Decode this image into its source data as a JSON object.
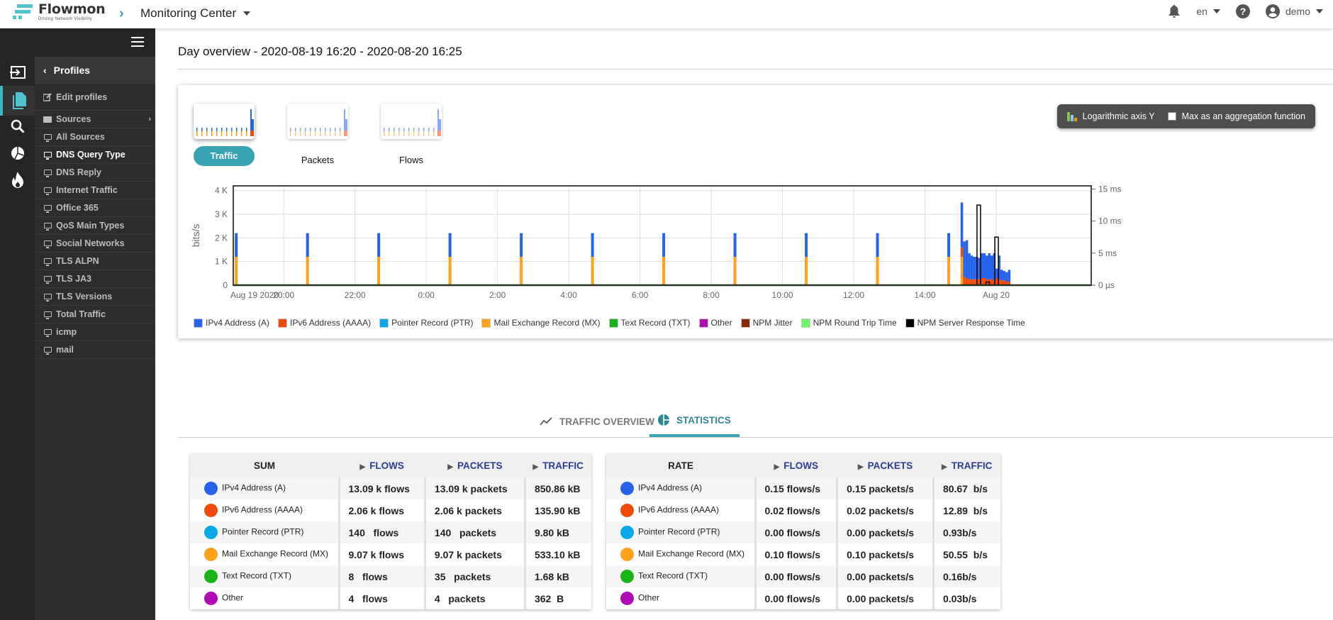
{
  "app": {
    "logo_name": "Flowmon",
    "logo_tagline": "Driving Network Visibility",
    "breadcrumb": "Monitoring Center",
    "language": "en",
    "user": "demo",
    "brand_color": "#37a3b3"
  },
  "sidebar": {
    "header": "Profiles",
    "edit": "Edit profiles",
    "sources": "Sources",
    "items": [
      {
        "label": "All Sources",
        "active": false
      },
      {
        "label": "DNS Query Type",
        "active": true
      },
      {
        "label": "DNS Reply",
        "active": false
      },
      {
        "label": "Internet Traffic",
        "active": false
      },
      {
        "label": "Office 365",
        "active": false
      },
      {
        "label": "QoS Main Types",
        "active": false
      },
      {
        "label": "Social Networks",
        "active": false
      },
      {
        "label": "TLS ALPN",
        "active": false
      },
      {
        "label": "TLS JA3",
        "active": false
      },
      {
        "label": "TLS Versions",
        "active": false
      },
      {
        "label": "Total Traffic",
        "active": false
      },
      {
        "label": "icmp",
        "active": false
      },
      {
        "label": "mail",
        "active": false
      }
    ],
    "rail_icons": [
      "sign-in-icon",
      "profiles-icon",
      "search-icon",
      "pie-chart-icon",
      "fire-icon"
    ]
  },
  "page": {
    "title": "Day overview - 2020-08-19 16:20 - 2020-08-20 16:25"
  },
  "thumbs": [
    {
      "label": "Traffic",
      "active": true
    },
    {
      "label": "Packets",
      "active": false
    },
    {
      "label": "Flows",
      "active": false
    }
  ],
  "options": {
    "log_axis": "Logarithmic axis Y",
    "max_agg": "Max as an aggregation function",
    "max_agg_checked": false
  },
  "chart_data": {
    "type": "bar",
    "stacked": true,
    "ylabel": "bits/s",
    "y_ticks": [
      "0",
      "1 K",
      "2 K",
      "3 K",
      "4 K"
    ],
    "ylim": [
      0,
      4200
    ],
    "y2_ticks": [
      "0 µs",
      "5 ms",
      "10 ms",
      "15 ms"
    ],
    "y2lim": [
      0,
      15.5
    ],
    "x_ticks": [
      "Aug 19 2020",
      "20:00",
      "22:00",
      "0:00",
      "2:00",
      "4:00",
      "6:00",
      "8:00",
      "10:00",
      "12:00",
      "14:00",
      "Aug 20"
    ],
    "grid": true,
    "periodic_spikes": {
      "times": [
        "18:40",
        "20:40",
        "22:40",
        "0:40",
        "2:40",
        "4:40",
        "6:40",
        "8:40",
        "10:40",
        "12:40",
        "14:40"
      ],
      "ipv4": 1000,
      "mx": 1200
    },
    "tail_series": {
      "start": "15:00",
      "ipv4": [
        1900,
        1500,
        1600,
        1100,
        1000,
        950,
        950,
        900,
        1050,
        1050,
        1000,
        1100,
        1000,
        1150,
        400,
        1000,
        450,
        400,
        400,
        500
      ],
      "ipv6": [
        400,
        350,
        300,
        250,
        250,
        250,
        250,
        250,
        300,
        300,
        250,
        250,
        250,
        200,
        300,
        250,
        200,
        200,
        150,
        150
      ],
      "mx": [
        1200,
        0,
        0,
        0,
        0,
        0,
        0,
        0,
        0,
        0,
        0,
        0,
        0,
        0,
        0,
        0,
        0,
        0,
        0,
        0
      ],
      "srt_ms": [
        {
          "time": "15:30",
          "value": 12.5
        },
        {
          "time": "16:00",
          "value": 7.5
        },
        {
          "time": "15:45",
          "value": 0.5
        }
      ]
    },
    "legend": [
      {
        "name": "IPv4 Address (A)",
        "color": "#2563eb"
      },
      {
        "name": "IPv6 Address (AAAA)",
        "color": "#f04a0a"
      },
      {
        "name": "Pointer Record (PTR)",
        "color": "#0aa8e8"
      },
      {
        "name": "Mail Exchange Record (MX)",
        "color": "#ffa11a"
      },
      {
        "name": "Text Record (TXT)",
        "color": "#1ab31a"
      },
      {
        "name": "Other",
        "color": "#b00ab6"
      },
      {
        "name": "NPM Jitter",
        "color": "#8a2a0a"
      },
      {
        "name": "NPM Round Trip Time",
        "color": "#6af765"
      },
      {
        "name": "NPM Server Response Time",
        "color": "#000000"
      }
    ]
  },
  "tabs": [
    {
      "label": "TRAFFIC OVERVIEW",
      "active": false
    },
    {
      "label": "STATISTICS",
      "active": true
    }
  ],
  "sum_table": {
    "title": "SUM",
    "columns": [
      "FLOWS",
      "PACKETS",
      "TRAFFIC"
    ],
    "rows": [
      {
        "name": "IPv4 Address (A)",
        "color": "#2563eb",
        "flows": "13.09 k flows",
        "packets": "13.09 k packets",
        "traffic": "850.86 kB"
      },
      {
        "name": "IPv6 Address (AAAA)",
        "color": "#f04a0a",
        "flows": "2.06 k flows",
        "packets": "2.06 k packets",
        "traffic": "135.90 kB"
      },
      {
        "name": "Pointer Record (PTR)",
        "color": "#0aa8e8",
        "flows": "140   flows",
        "packets": "140   packets",
        "traffic": "9.80 kB"
      },
      {
        "name": "Mail Exchange Record (MX)",
        "color": "#ffa11a",
        "flows": "9.07 k flows",
        "packets": "9.07 k packets",
        "traffic": "533.10 kB"
      },
      {
        "name": "Text Record (TXT)",
        "color": "#1ab31a",
        "flows": "8   flows",
        "packets": "35   packets",
        "traffic": "1.68 kB"
      },
      {
        "name": "Other",
        "color": "#b00ab6",
        "flows": "4   flows",
        "packets": "4   packets",
        "traffic": "362  B"
      }
    ]
  },
  "rate_table": {
    "title": "RATE",
    "columns": [
      "FLOWS",
      "PACKETS",
      "TRAFFIC"
    ],
    "rows": [
      {
        "name": "IPv4 Address (A)",
        "color": "#2563eb",
        "flows": "0.15 flows/s",
        "packets": "0.15 packets/s",
        "traffic": "80.67  b/s"
      },
      {
        "name": "IPv6 Address (AAAA)",
        "color": "#f04a0a",
        "flows": "0.02 flows/s",
        "packets": "0.02 packets/s",
        "traffic": "12.89  b/s"
      },
      {
        "name": "Pointer Record (PTR)",
        "color": "#0aa8e8",
        "flows": "0.00 flows/s",
        "packets": "0.00 packets/s",
        "traffic": "0.93b/s"
      },
      {
        "name": "Mail Exchange Record (MX)",
        "color": "#ffa11a",
        "flows": "0.10 flows/s",
        "packets": "0.10 packets/s",
        "traffic": "50.55  b/s"
      },
      {
        "name": "Text Record (TXT)",
        "color": "#1ab31a",
        "flows": "0.00 flows/s",
        "packets": "0.00 packets/s",
        "traffic": "0.16b/s"
      },
      {
        "name": "Other",
        "color": "#b00ab6",
        "flows": "0.00 flows/s",
        "packets": "0.00 packets/s",
        "traffic": "0.03b/s"
      }
    ]
  }
}
